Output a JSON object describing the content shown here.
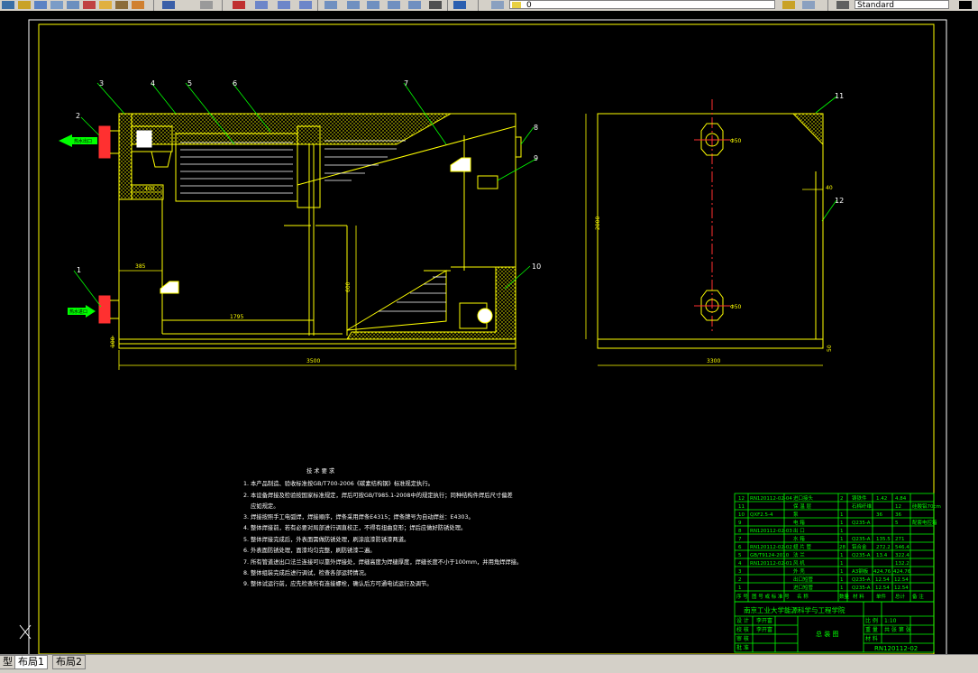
{
  "toolbar": {
    "layer_value": "0",
    "style_value": "Standard"
  },
  "drawing": {
    "tech_title": "技 术 要 求",
    "tech_notes": [
      "1. 本产品制造、验收标准按GB/T700-2006《碳素结构钢》标准规定执行。",
      "2. 本设备焊接及检验按国家标准规定，焊后可按GB/T985.1-2008中的规定执行；同种结构件焊后尺寸偏差",
      "应如规定。",
      "3. 焊接按照手工电弧焊，焊接顺序，焊条采用焊条E4315；焊条牌号为自动焊丝：E4303。",
      "4. 整体焊接前，若有必要对局部进行调直校正，不得有扭曲变形；焊后应做好防锈处理。",
      "5. 整体焊接完成后，外表面需做防锈处理，刷涂底漆防锈漆两道。",
      "6. 外表面防锈处理，面漆均匀完整，刷防锈漆二遍。",
      "7. 所有管道进出口法兰连接可以靠外焊接处，焊缝高度为焊缝厚度，焊缝长度不小于100mm，并用角焊焊接。",
      "8. 整体组装完成后进行调试，检查各部运转情况。",
      "9. 整体试运行前，应先检查所有连接螺栓，确认后方可通电试运行及调节。"
    ],
    "callouts": [
      "1",
      "2",
      "3",
      "4",
      "5",
      "6",
      "7",
      "8",
      "9",
      "10",
      "11",
      "12"
    ],
    "dimensions": {
      "d3500": "3500",
      "d3300": "3300",
      "d2000": "2000",
      "d1795": "1795",
      "d385": "385",
      "d400": "400",
      "d600": "600",
      "d40": "40",
      "d50": "50",
      "d100": "100",
      "phi50a": "Φ50",
      "phi50b": "Φ50"
    },
    "bom_rows": [
      {
        "no": "12",
        "code": "RN120112-02-04",
        "name": "进口接头",
        "qty": "2",
        "material": "铸铁件",
        "weight": "1.42",
        "total": "4.84",
        "note": ""
      },
      {
        "no": "11",
        "code": "",
        "name": "保 温 层",
        "qty": "",
        "material": "石棉纤维",
        "weight": "",
        "total": "12",
        "note": "硅酸铝70cm"
      },
      {
        "no": "10",
        "code": "QXF2.5-4",
        "name": "泵",
        "qty": "1",
        "material": "",
        "weight": "36",
        "total": "36",
        "note": ""
      },
      {
        "no": "9",
        "code": "",
        "name": "电 箱",
        "qty": "1",
        "material": "Q235-A",
        "weight": "",
        "total": "5",
        "note": "配套电控箱"
      },
      {
        "no": "8",
        "code": "RN120112-02-03",
        "name": "出 口",
        "qty": "1",
        "material": "",
        "weight": "",
        "total": "",
        "note": ""
      },
      {
        "no": "7",
        "code": "",
        "name": "水 箱",
        "qty": "1",
        "material": "Q235-A",
        "weight": "135.5",
        "total": "271",
        "note": ""
      },
      {
        "no": "6",
        "code": "RN120112-02-02",
        "name": "翅 片 管",
        "qty": "28",
        "material": "铝合金",
        "weight": "272.2",
        "total": "546.4",
        "note": ""
      },
      {
        "no": "5",
        "code": "GB/T9124-2010",
        "name": "法 兰",
        "qty": "1",
        "material": "Q235-A",
        "weight": "13.4",
        "total": "322.4",
        "note": ""
      },
      {
        "no": "4",
        "code": "RN120112-02-01",
        "name": "风 机",
        "qty": "1",
        "material": "",
        "weight": "",
        "total": "132.2",
        "note": ""
      },
      {
        "no": "3",
        "code": "",
        "name": "外 壳",
        "qty": "1",
        "material": "A3钢板",
        "weight": "424.76",
        "total": "424.76",
        "note": ""
      },
      {
        "no": "2",
        "code": "",
        "name": "出口短管",
        "qty": "1",
        "material": "Q235-A",
        "weight": "12.54",
        "total": "12.54",
        "note": ""
      },
      {
        "no": "1",
        "code": "",
        "name": "进口短管",
        "qty": "1",
        "material": "Q235-A",
        "weight": "12.54",
        "total": "12.54",
        "note": ""
      }
    ],
    "bom_header": [
      "序 号",
      "图 号 或 标 准 号",
      "名 称",
      "数量",
      "材 料",
      "单件",
      "总计",
      "备 注"
    ],
    "school": "南京工业大学能源科学与工程学院",
    "title_block": {
      "design": "设 计",
      "designer": "李开富",
      "check": "校 核",
      "checker": "李开富",
      "review": "审 核",
      "approve": "批 准",
      "drawing_name": "总 装 图",
      "scale_label": "比 例",
      "scale": "1:10",
      "sheet_label": "张 数",
      "sheet": "共 张 第 张",
      "drawing_no": "RN120112-02",
      "weight_label": "重 量",
      "material_label": "材 料"
    },
    "inlet_tag": "热水进口",
    "outlet_tag": "热水出口"
  },
  "tabs": [
    "型",
    "布局1",
    "布局2"
  ]
}
